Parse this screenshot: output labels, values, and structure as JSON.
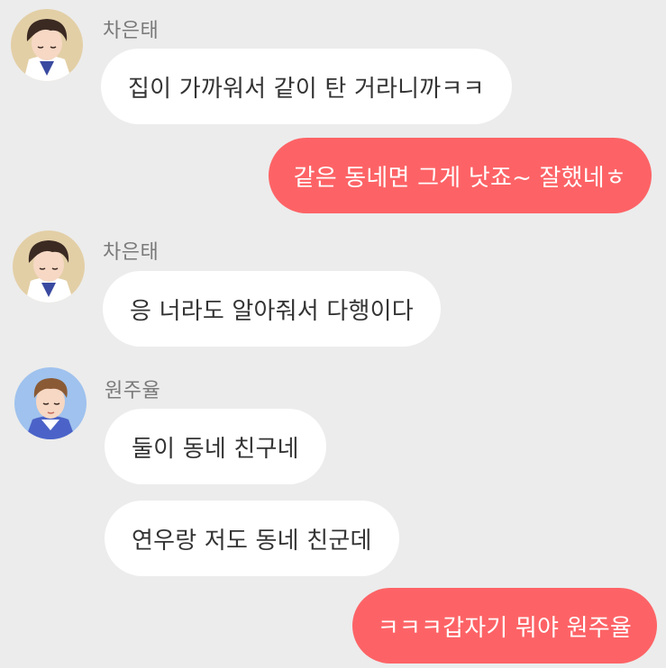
{
  "colors": {
    "background": "#ececec",
    "incoming_bubble": "#ffffff",
    "outgoing_bubble": "#fd6366",
    "sender_name": "#7a7a7a"
  },
  "messages": [
    {
      "sender": "차은태",
      "text": "집이 가까워서 같이 탄 거라니까ㅋㅋ"
    },
    {
      "text": "같은 동네면 그게 낫죠~ 잘했네ㅎ"
    },
    {
      "sender": "차은태",
      "text": "응 너라도 알아줘서 다행이다"
    },
    {
      "sender": "원주율",
      "text": "둘이 동네 친구네"
    },
    {
      "text": "연우랑 저도 동네 친군데"
    },
    {
      "text": "ㅋㅋㅋ갑자기 뭐야 원주율"
    }
  ]
}
